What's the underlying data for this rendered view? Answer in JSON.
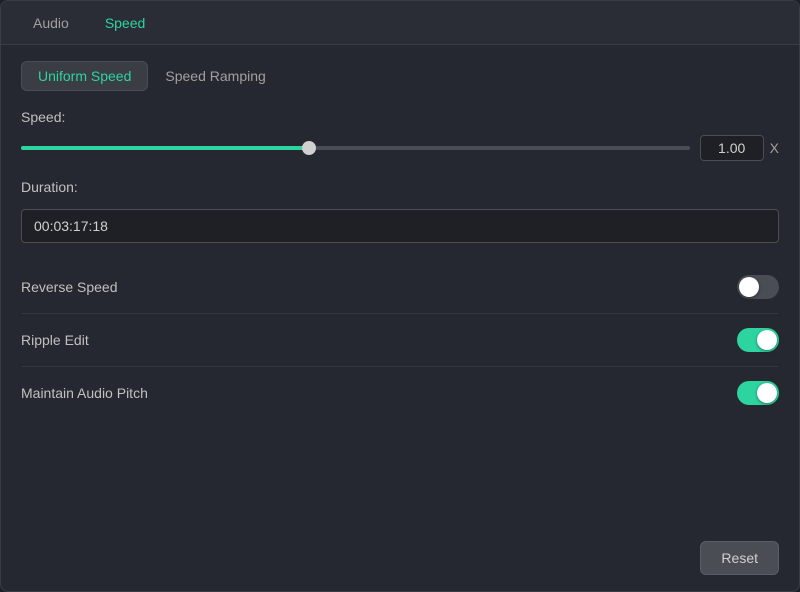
{
  "top_tabs": {
    "audio_label": "Audio",
    "speed_label": "Speed",
    "active": "Speed"
  },
  "sub_tabs": {
    "uniform_speed_label": "Uniform Speed",
    "speed_ramping_label": "Speed Ramping",
    "active": "Uniform Speed"
  },
  "speed": {
    "label": "Speed:",
    "value": "1.00",
    "x_label": "X",
    "slider_percent": 43
  },
  "duration": {
    "label": "Duration:",
    "value": "00:03:17:18",
    "placeholder": "00:03:17:18"
  },
  "toggles": [
    {
      "id": "reverse-speed",
      "label": "Reverse Speed",
      "state": "off"
    },
    {
      "id": "ripple-edit",
      "label": "Ripple Edit",
      "state": "on"
    },
    {
      "id": "maintain-audio-pitch",
      "label": "Maintain Audio Pitch",
      "state": "on"
    }
  ],
  "footer": {
    "reset_label": "Reset"
  }
}
